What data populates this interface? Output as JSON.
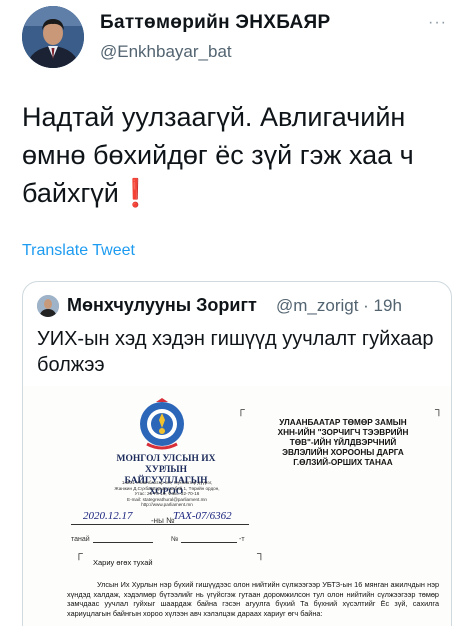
{
  "author": {
    "name": "Баттөмөрийн ЭНХБАЯР",
    "handle": "@Enkhbayar_bat"
  },
  "more_icon": "···",
  "tweet": {
    "text": "Надтай уулзаагүй. Авлигачийн өмнө бөхийдөг ёс зүй гэж хаа ч байхгүй",
    "emoji": "❗"
  },
  "translate_label": "Translate Tweet",
  "quoted": {
    "name": "Мөнхчулууны Зоригт",
    "handle": "@m_zorigt · 19h",
    "text": "УИХ-ын хэд хэдэн гишүүд уучлалт гуйхаар болжээ",
    "letter": {
      "org_line1": "МОНГОЛ УЛСЫН ИХ ХУРЛЫН",
      "org_line2": "БАЙГУУЛЛАГЫН ХОРОО",
      "address": [
        "14201 Улаанбаатар хот, Сүхбаатар дүүрэг,",
        "Жанжин Д.Сүхбаатарын талбай 1, Төрийн ордон,",
        "Утас: 26-70-15, Факс: 32-70-16",
        "E-mail: stategreathural@parliament.mn",
        "http://www.parliament.mn"
      ],
      "recipient": [
        "УЛААНБААТАР ТӨМӨР ЗАМЫН",
        "ХНН-ИЙН \"ЗОРЧИГЧ ТЭЭВРИЙН",
        "ТӨВ\"-ИЙН ҮЙЛДВЭРЧНИЙ",
        "ЭВЛЭЛИЙН ХОРООНЫ ДАРГА",
        "Г.ӨЛЗИЙ-ОРШИХ ТАНАА"
      ],
      "date_handwritten": "2020.12.17",
      "date_separator": "-ны №",
      "doc_number_handwritten": "ТАХ-07/6362",
      "tanai_label": "танай",
      "no_label": "№",
      "t_label": "-т",
      "subject": "Хариу өгөх тухай",
      "paragraph": "Улсын Их Хурлын нэр бүхий гишүүдээс олон нийтийн сүлжээгээр УБТЗ-ын 16 мянган ажилчдын нэр хүндэд халдаж, хэдэлмөр бүтээлийг нь үгүйсгэж гутаан доромжилсон тул олон нийтийн сүлжээгээр төмөр замчдаас уучлал гуйхыг шаардаж байна гэсэн агуулга бүхий Та бүхний хүсэлтийг Ёс зүй, сахилга хариуцлагын байнгын хороо хүлээн авч хэлэлцэж дараах хариуг өгч байна:"
    }
  }
}
